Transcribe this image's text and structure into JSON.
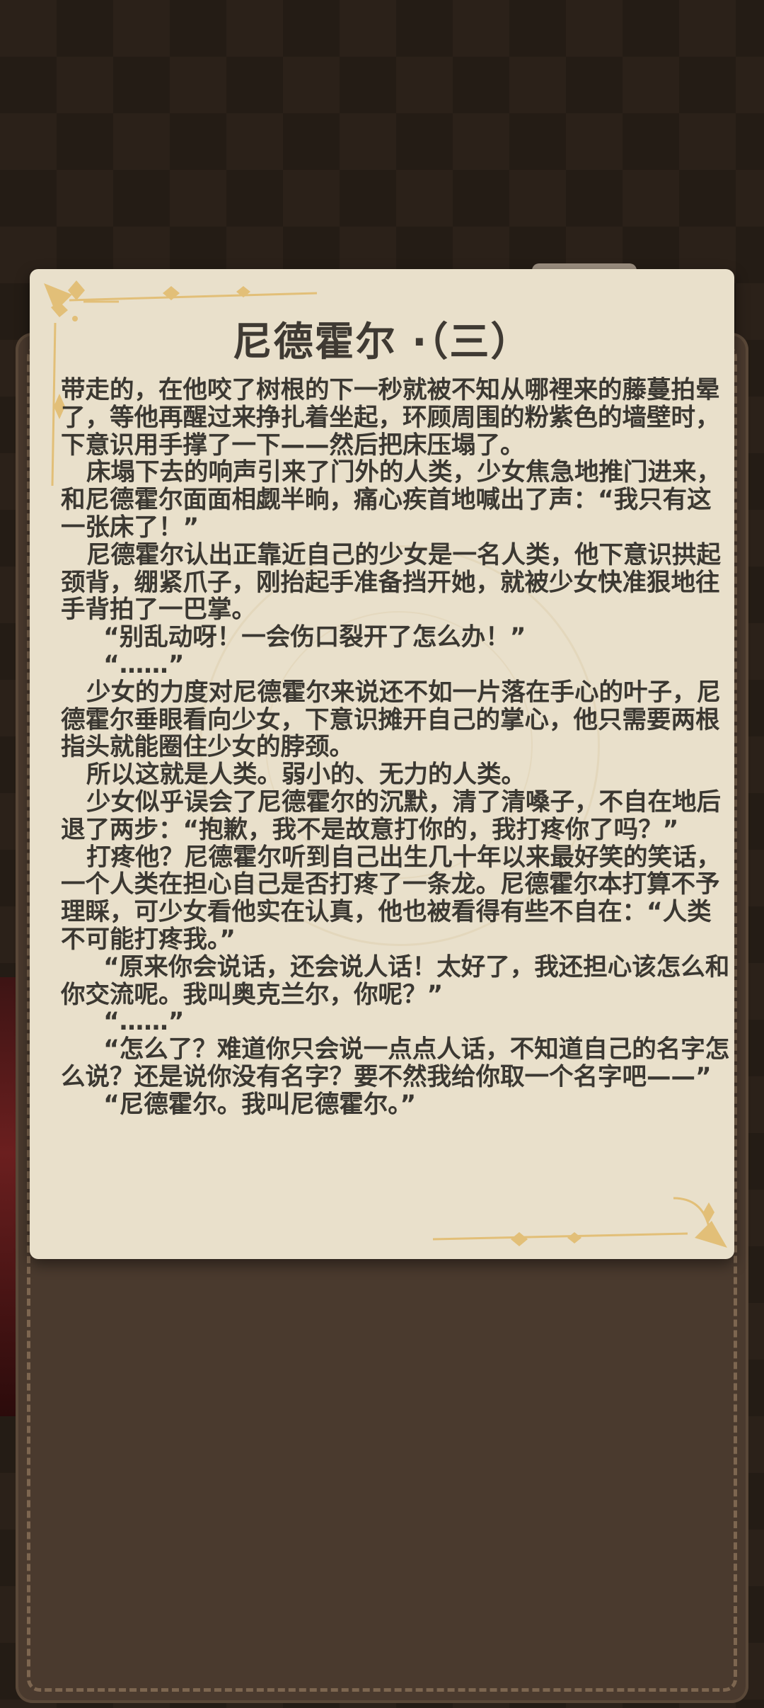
{
  "chapter": {
    "title": "尼德霍尔 ·（三）",
    "paragraphs": [
      "带走的，在他咬了树根的下一秒就被不知从哪裡来的藤蔓拍晕了，等他再醒过来挣扎着坐起，环顾周围的粉紫色的墙壁时，下意识用手撑了一下——然后把床压塌了。",
      "   床塌下去的响声引来了门外的人类，少女焦急地推门进来，和尼德霍尔面面相觑半晌，痛心疾首地喊出了声：“我只有这一张床了！”",
      "   尼德霍尔认出正靠近自己的少女是一名人类，他下意识拱起颈背，绷紧爪子，刚抬起手准备挡开她，就被少女快准狠地往手背拍了一巴掌。",
      "     “别乱动呀！一会伤口裂开了怎么办！”",
      "     “……”",
      "   少女的力度对尼德霍尔来说还不如一片落在手心的叶子，尼德霍尔垂眼看向少女，下意识摊开自己的掌心，他只需要两根指头就能圈住少女的脖颈。",
      "   所以这就是人类。弱小的、无力的人类。",
      "   少女似乎误会了尼德霍尔的沉默，清了清嗓子，不自在地后退了两步：“抱歉，我不是故意打你的，我打疼你了吗？”",
      "   打疼他？尼德霍尔听到自己出生几十年以来最好笑的笑话，一个人类在担心自己是否打疼了一条龙。尼德霍尔本打算不予理睬，可少女看他实在认真，他也被看得有些不自在：“人类不可能打疼我。”",
      "     “原来你会说话，还会说人话！太好了，我还担心该怎么和你交流呢。我叫奥克兰尔，你呢？”",
      "     “……”",
      "     “怎么了？难道你只会说一点点人话，不知道自己的名字怎么说？还是说你没有名字？要不然我给你取一个名字吧——”",
      "     “尼德霍尔。我叫尼德霍尔。”"
    ]
  },
  "colors": {
    "card": "#e9e0cb",
    "text": "#3b3832",
    "ornament": "#e2bf78",
    "board": "#4a3a2e"
  },
  "icons": {
    "corner_top_left": "gold-star-flourish-icon",
    "corner_bottom_right": "gold-star-flourish-icon"
  }
}
